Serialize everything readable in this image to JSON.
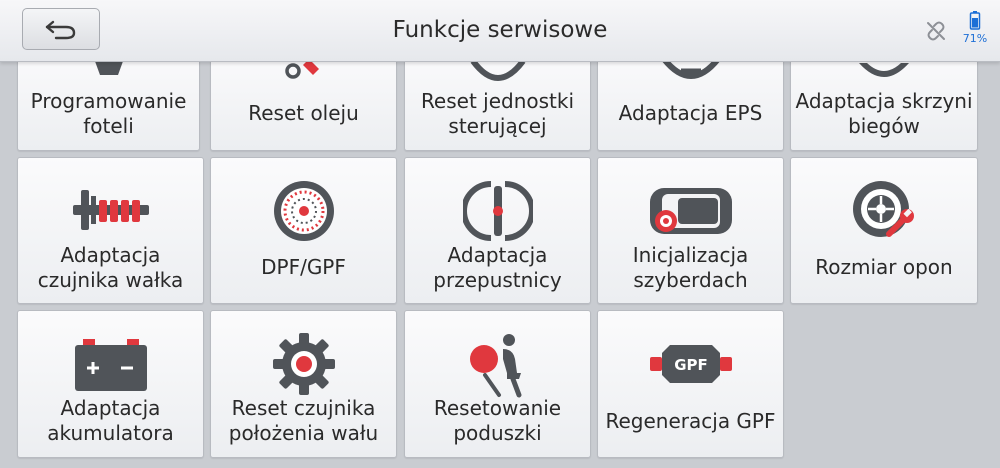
{
  "header": {
    "title": "Funkcje serwisowe",
    "battery_percent": "71%",
    "accent_color": "#1d6fd6"
  },
  "colors": {
    "icon_gray": "#505459",
    "icon_red": "#e0383e"
  },
  "tiles": [
    {
      "label": "Programowanie foteli",
      "icon": "seat-icon"
    },
    {
      "label": "Reset oleju",
      "icon": "oil-can-icon"
    },
    {
      "label": "Reset jednostki sterującej",
      "icon": "control-unit-icon"
    },
    {
      "label": "Adaptacja EPS",
      "icon": "steering-wheel-icon"
    },
    {
      "label": "Adaptacja skrzyni biegów",
      "icon": "gearbox-icon"
    },
    {
      "label": "Adaptacja czujnika wałka",
      "icon": "camshaft-sensor-icon"
    },
    {
      "label": "DPF/GPF",
      "icon": "particulate-filter-icon"
    },
    {
      "label": "Adaptacja przepustnicy",
      "icon": "throttle-icon"
    },
    {
      "label": "Inicjalizacja szyberdach",
      "icon": "sunroof-icon"
    },
    {
      "label": "Rozmiar opon",
      "icon": "tire-wrench-icon"
    },
    {
      "label": "Adaptacja akumulatora",
      "icon": "battery-icon"
    },
    {
      "label": "Reset czujnika położenia wału",
      "icon": "gear-sensor-icon"
    },
    {
      "label": "Resetowanie poduszki",
      "icon": "airbag-icon"
    },
    {
      "label": "Regeneracja GPF",
      "icon": "gpf-icon",
      "icon_text": "GPF"
    }
  ]
}
